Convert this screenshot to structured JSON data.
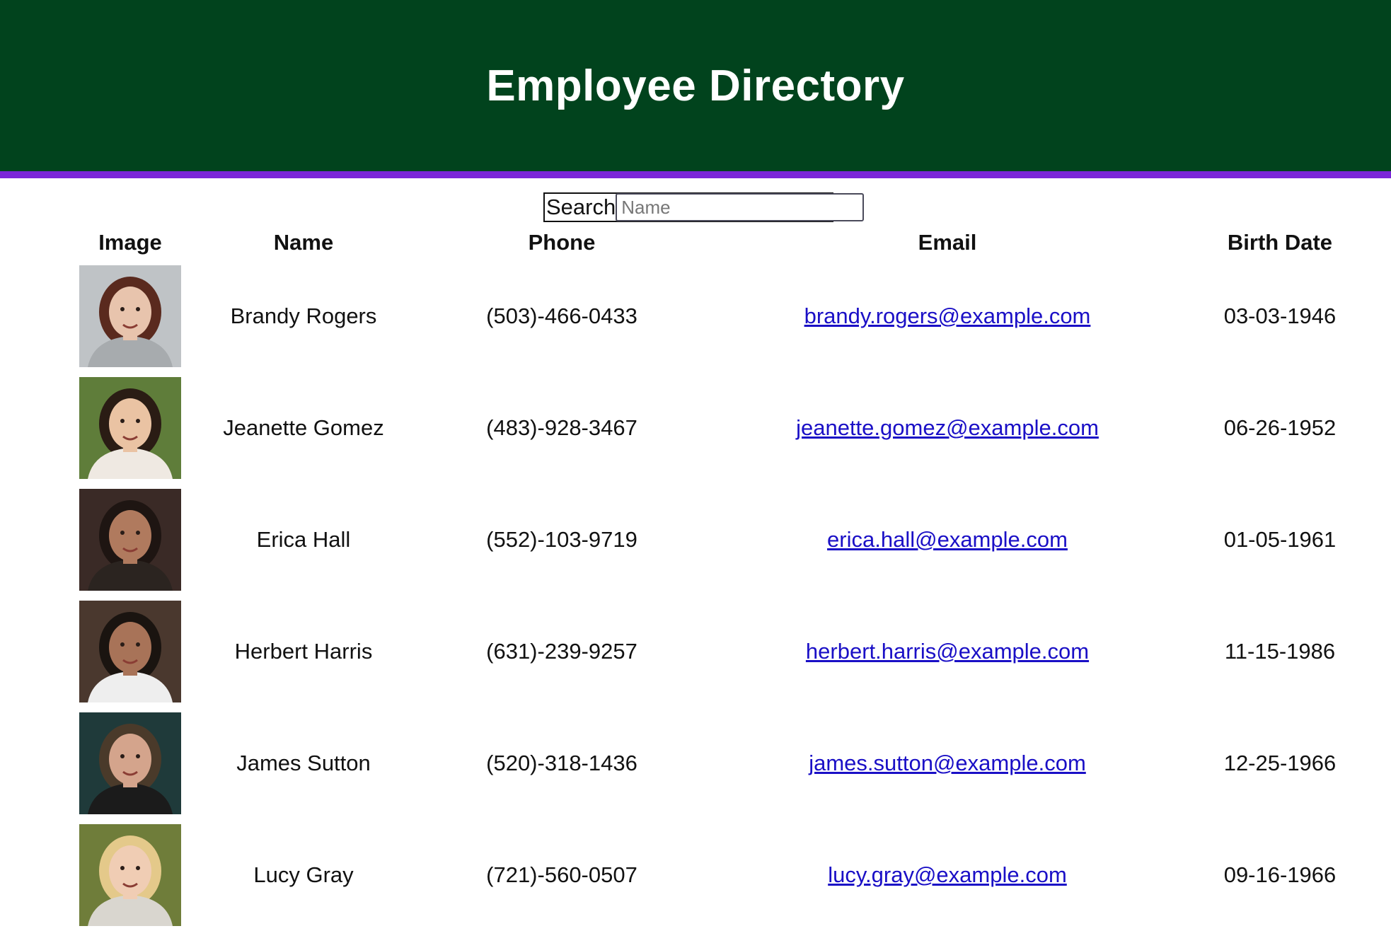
{
  "header": {
    "title": "Employee Directory"
  },
  "search": {
    "label": "Search",
    "placeholder": "Name",
    "value": ""
  },
  "table": {
    "columns": [
      "Image",
      "Name",
      "Phone",
      "Email",
      "Birth Date"
    ],
    "rows": [
      {
        "name": "Brandy Rogers",
        "phone": "(503)-466-0433",
        "email": "brandy.rogers@example.com",
        "birth": "03-03-1946",
        "bg": "#bfc3c6",
        "skin": "#e8c4ad",
        "hair": "#5a2a1e",
        "shirt": "#a7abae"
      },
      {
        "name": "Jeanette Gomez",
        "phone": "(483)-928-3467",
        "email": "jeanette.gomez@example.com",
        "birth": "06-26-1952",
        "bg": "#5f7d3a",
        "skin": "#eac3a3",
        "hair": "#2a1c14",
        "shirt": "#efe9e2"
      },
      {
        "name": "Erica Hall",
        "phone": "(552)-103-9719",
        "email": "erica.hall@example.com",
        "birth": "01-05-1961",
        "bg": "#3a2a26",
        "skin": "#b07a5e",
        "hair": "#1e1512",
        "shirt": "#2b2420"
      },
      {
        "name": "Herbert Harris",
        "phone": "(631)-239-9257",
        "email": "herbert.harris@example.com",
        "birth": "11-15-1986",
        "bg": "#4a382e",
        "skin": "#a87358",
        "hair": "#1a1410",
        "shirt": "#eeeeee"
      },
      {
        "name": "James Sutton",
        "phone": "(520)-318-1436",
        "email": "james.sutton@example.com",
        "birth": "12-25-1966",
        "bg": "#1f3a3a",
        "skin": "#d4a48c",
        "hair": "#4a3a2a",
        "shirt": "#1b1b1b"
      },
      {
        "name": "Lucy Gray",
        "phone": "(721)-560-0507",
        "email": "lucy.gray@example.com",
        "birth": "09-16-1966",
        "bg": "#6f7d3a",
        "skin": "#f0cdb4",
        "hair": "#e4c98a",
        "shirt": "#d9d6cf"
      }
    ]
  }
}
